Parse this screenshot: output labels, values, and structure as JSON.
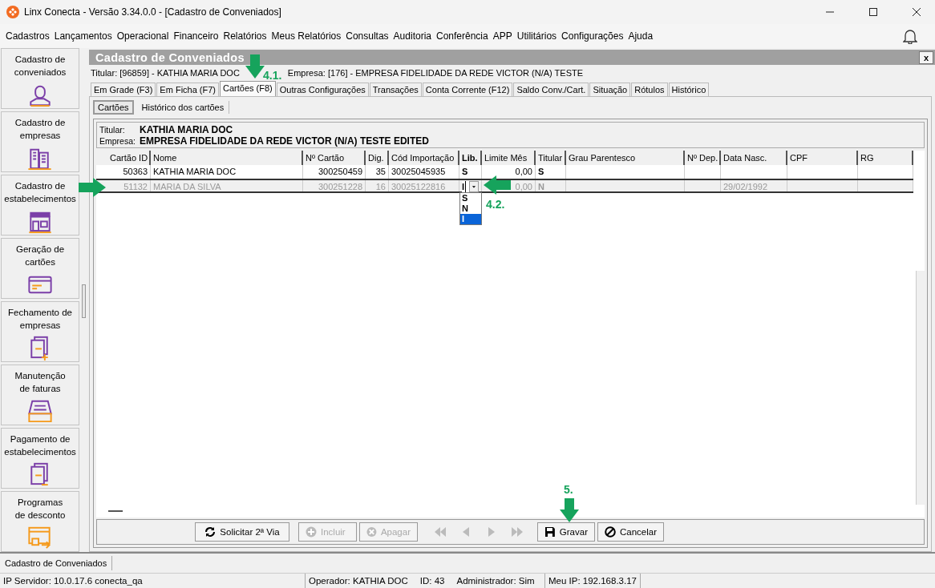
{
  "window": {
    "title": "Linx Conecta - Versão 3.34.0.0 - [Cadastro de Conveniados]"
  },
  "menu": [
    "Cadastros",
    "Lançamentos",
    "Operacional",
    "Financeiro",
    "Relatórios",
    "Meus Relatórios",
    "Consultas",
    "Auditoria",
    "Conferência",
    "APP",
    "Utilitários",
    "Configurações",
    "Ajuda"
  ],
  "sidebar": {
    "items": [
      {
        "label": "Cadastro de\nconveniados"
      },
      {
        "label": "Cadastro de\nempresas"
      },
      {
        "label": "Cadastro de\nestabelecimentos"
      },
      {
        "label": "Geração de\ncartões"
      },
      {
        "label": "Fechamento de\nempresas"
      },
      {
        "label": "Manutenção\nde faturas"
      },
      {
        "label": "Pagamento de\nestabelecimentos"
      },
      {
        "label": "Programas\nde desconto"
      }
    ]
  },
  "form": {
    "title": "Cadastro de Conveniados",
    "close": "x",
    "titular": "Titular: [96859] - KATHIA MARIA DOC",
    "empresa": "Empresa: [176] - EMPRESA FIDELIDADE DA REDE VICTOR (N/A) TESTE"
  },
  "tabs": [
    {
      "label": "Em Grade (F3)",
      "selected": false
    },
    {
      "label": "Em Ficha (F7)",
      "selected": false
    },
    {
      "label": "Cartões (F8)",
      "selected": true
    },
    {
      "label": "Outras Configurações",
      "selected": false
    },
    {
      "label": "Transações",
      "selected": false
    },
    {
      "label": "Conta Corrente (F12)",
      "selected": false
    },
    {
      "label": "Saldo Conv./Cart.",
      "selected": false
    },
    {
      "label": "Situação",
      "selected": false
    },
    {
      "label": "Rótulos",
      "selected": false
    },
    {
      "label": "Histórico",
      "selected": false
    }
  ],
  "subtabs": [
    {
      "label": "Cartões",
      "selected": true
    },
    {
      "label": "Histórico dos cartões",
      "selected": false
    }
  ],
  "summary": {
    "titular_label": "Titular:",
    "titular": "KATHIA MARIA DOC",
    "empresa_label": "Empresa:",
    "empresa": "EMPRESA FIDELIDADE DA REDE VICTOR (N/A) TESTE EDITED"
  },
  "table": {
    "columns": [
      {
        "label": "Cartão ID",
        "active": false
      },
      {
        "label": "Nome",
        "active": false
      },
      {
        "label": "Nº Cartão",
        "active": false
      },
      {
        "label": "Dig.",
        "active": false
      },
      {
        "label": "Cód Importação",
        "active": false
      },
      {
        "label": "Lib.",
        "active": true
      },
      {
        "label": "Limite Mês",
        "active": false
      },
      {
        "label": "Titular",
        "active": false
      },
      {
        "label": "Grau Parentesco",
        "active": false
      },
      {
        "label": "Nº Dep.",
        "active": false
      },
      {
        "label": "Data Nasc.",
        "active": false
      },
      {
        "label": "CPF",
        "active": false
      },
      {
        "label": "RG",
        "active": false
      }
    ],
    "rows": [
      {
        "selected": false,
        "cells": [
          "50363",
          "KATHIA MARIA DOC",
          "300250459",
          "35",
          "30025045935",
          "S",
          "0,00",
          "S",
          null,
          null,
          null,
          null,
          null
        ]
      },
      {
        "selected": true,
        "cells": [
          "51132",
          "MARIA DA SILVA",
          "300251228",
          "16",
          "30025122816",
          {
            "value": "I",
            "options": [
              {
                "label": "S",
                "selected": false
              },
              {
                "label": "N",
                "selected": false
              },
              {
                "label": "I",
                "selected": true
              }
            ]
          },
          "0,00",
          "N",
          null,
          null,
          "29/02/1992",
          null,
          null
        ]
      }
    ]
  },
  "toolbar": [
    {
      "kind": "refresh",
      "label": "Solicitar 2ª Via",
      "disabled": false
    },
    {
      "kind": "add",
      "label": "Incluir",
      "disabled": true
    },
    {
      "kind": "delete",
      "label": "Apagar",
      "disabled": true
    },
    {
      "kind": "first",
      "disabled": true
    },
    {
      "kind": "prev",
      "disabled": true
    },
    {
      "kind": "next",
      "disabled": true
    },
    {
      "kind": "last",
      "disabled": true
    },
    {
      "kind": "save",
      "label": "Gravar",
      "disabled": false
    },
    {
      "kind": "cancel",
      "label": "Cancelar",
      "disabled": false
    }
  ],
  "annotations": [
    {
      "label": "4.1.",
      "kind": "down"
    },
    {
      "kind": "right"
    },
    {
      "label": "4.2.",
      "kind": "left"
    },
    {
      "label": "5.",
      "kind": "down"
    }
  ],
  "taskbar": {
    "tabs": [
      "Cadastro de Conveniados"
    ]
  },
  "status_bar": [
    [
      "IP Servidor: 10.0.17.6 conecta_qa"
    ],
    [
      "Operador: KATHIA DOC",
      "ID: 43",
      "Administrador: Sim"
    ],
    [
      "Meu IP: 192.168.3.17"
    ]
  ]
}
